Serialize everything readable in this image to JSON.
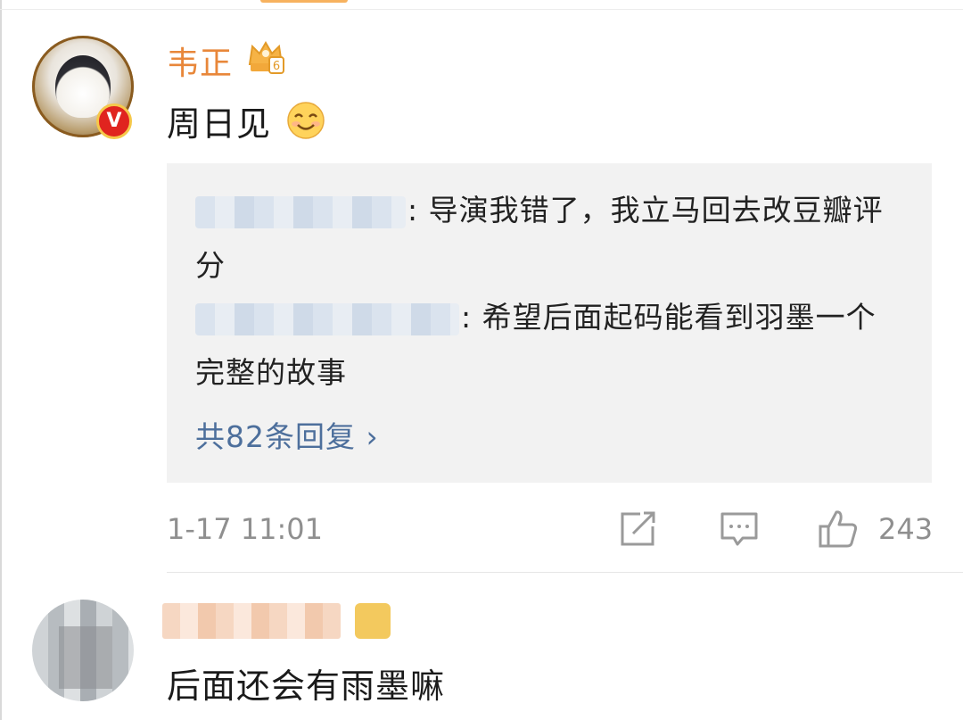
{
  "comment": {
    "username": "韦正",
    "level": "6",
    "verified_mark": "V",
    "text": "周日见",
    "emoji": "smile-emoji",
    "replies": [
      {
        "user_blurred": true,
        "text": ": 导演我错了，我立马回去改豆瓣评分"
      },
      {
        "user_blurred": true,
        "text": ": 希望后面起码能看到羽墨一个完整的故事"
      }
    ],
    "reply_count_label": "共82条回复 ›",
    "time": "1-17 11:01",
    "like_count": "243",
    "actions": [
      "repost-icon",
      "comment-icon",
      "like-icon"
    ]
  },
  "comment2": {
    "username_blurred": true,
    "text": "后面还会有雨墨嘛"
  },
  "colors": {
    "username": "#e8873a",
    "link": "#4d6f9c",
    "meta": "#8f8f8f",
    "panel": "#f2f2f2",
    "verified": "#e0241f"
  }
}
